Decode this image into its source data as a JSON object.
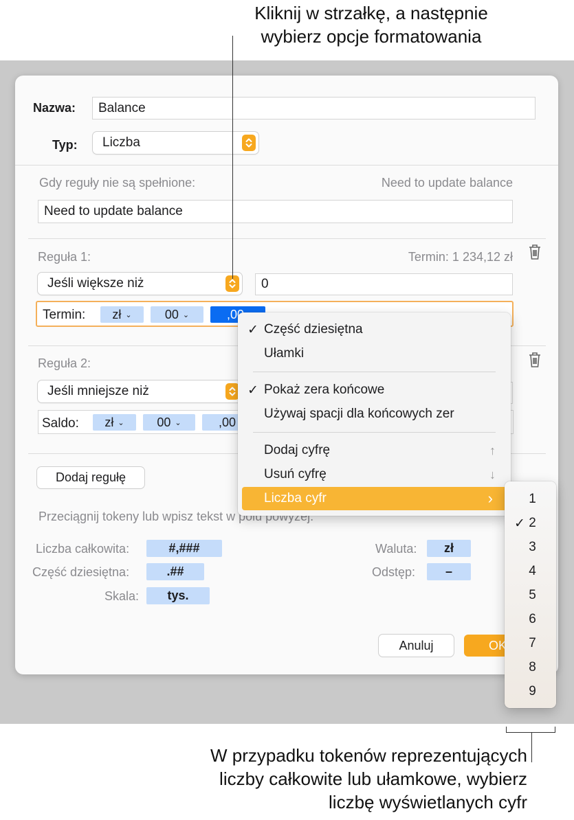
{
  "annotations": {
    "top_line1": "Kliknij w strzałkę, a następnie",
    "top_line2": "wybierz opcje formatowania",
    "bottom_line1": "W przypadku tokenów reprezentujących",
    "bottom_line2": "liczby całkowite lub ułamkowe, wybierz",
    "bottom_line3": "liczbę wyświetlanych cyfr"
  },
  "dialog": {
    "name_label": "Nazwa:",
    "name_value": "Balance",
    "type_label": "Typ:",
    "type_value": "Liczba",
    "unmet_label": "Gdy reguły nie są spełnione:",
    "unmet_preview": "Need to update balance",
    "unmet_value": "Need to update balance",
    "rule1": {
      "label": "Reguła 1:",
      "preview": "Termin: 1 234,12 zł",
      "condition": "Jeśli większe niż",
      "value": "0",
      "format_label": "Termin:",
      "tokens": [
        "zł",
        "00",
        ",00"
      ]
    },
    "rule2": {
      "label": "Reguła 2:",
      "condition": "Jeśli mniejsze niż",
      "format_label": "Saldo:",
      "tokens": [
        "zł",
        "00",
        ",00"
      ]
    },
    "add_rule_button": "Dodaj regułę",
    "hint": "Przeciągnij tokeny lub wpisz tekst w polu powyżej.",
    "token_palette": {
      "integer_label": "Liczba całkowita:",
      "integer_token": "#,###",
      "decimal_label": "Część dziesiętna:",
      "decimal_token": ".##",
      "scale_label": "Skala:",
      "scale_token": "tys.",
      "currency_label": "Waluta:",
      "currency_token": "zł",
      "spacing_label": "Odstęp:",
      "spacing_token": "–"
    },
    "cancel_button": "Anuluj",
    "ok_button": "OK"
  },
  "format_menu": {
    "items": [
      {
        "label": "Część dziesiętna",
        "checked": true
      },
      {
        "label": "Ułamki",
        "checked": false
      },
      {
        "label": "Pokaż zera końcowe",
        "checked": true
      },
      {
        "label": "Używaj spacji dla końcowych zer",
        "checked": false
      },
      {
        "label": "Dodaj cyfrę",
        "shortcut": "↑"
      },
      {
        "label": "Usuń cyfrę",
        "shortcut": "↓"
      },
      {
        "label": "Liczba cyfr",
        "submenu": true
      }
    ],
    "check_glyph": "✓",
    "submenu_arrow": "›"
  },
  "digits_submenu": {
    "options": [
      "1",
      "2",
      "3",
      "4",
      "5",
      "6",
      "7",
      "8",
      "9"
    ],
    "selected": "2"
  },
  "colors": {
    "accent": "#f7a81f",
    "token": "#c5dcfa",
    "token_selected": "#0a6cf2",
    "highlight": "#f8b534"
  }
}
